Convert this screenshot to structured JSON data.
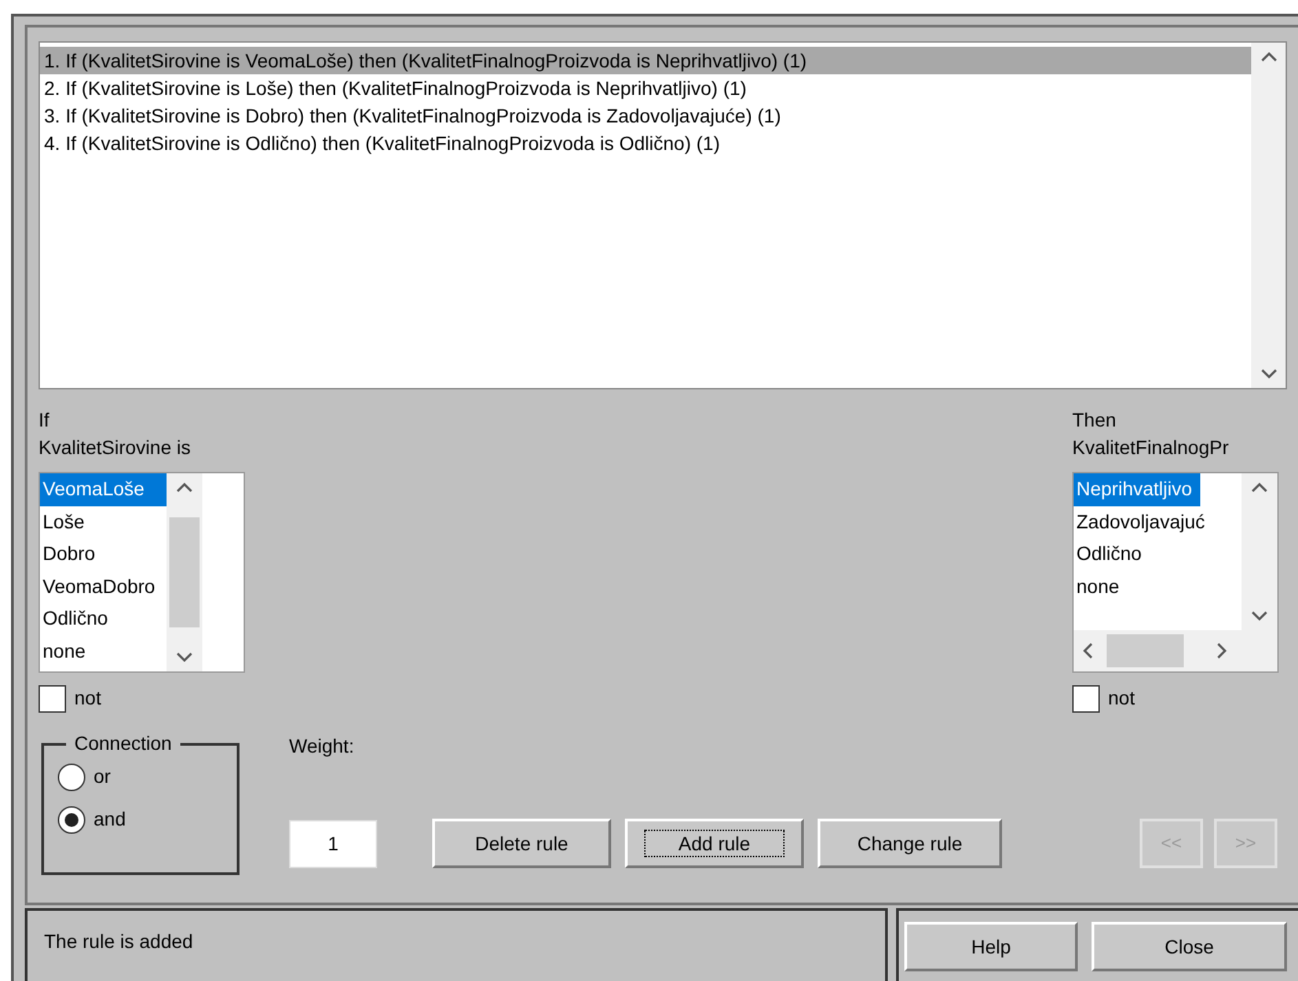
{
  "rules": [
    {
      "text": "1. If (KvalitetSirovine is VeomaLoše) then (KvalitetFinalnogProizvoda is Neprihvatljivo) (1)",
      "selected": true
    },
    {
      "text": "2. If (KvalitetSirovine is Loše) then (KvalitetFinalnogProizvoda is Neprihvatljivo) (1)",
      "selected": false
    },
    {
      "text": "3. If (KvalitetSirovine is Dobro) then (KvalitetFinalnogProizvoda is Zadovoljavajuće) (1)",
      "selected": false
    },
    {
      "text": "4. If (KvalitetSirovine is Odlično) then (KvalitetFinalnogProizvoda is Odlično) (1)",
      "selected": false
    }
  ],
  "if_panel": {
    "label": "If",
    "variable": "KvalitetSirovine is",
    "items": [
      {
        "label": "VeomaLoše",
        "selected": true
      },
      {
        "label": "Loše",
        "selected": false
      },
      {
        "label": "Dobro",
        "selected": false
      },
      {
        "label": "VeomaDobro",
        "selected": false
      },
      {
        "label": "Odlično",
        "selected": false
      },
      {
        "label": "none",
        "selected": false
      }
    ],
    "not": {
      "label": "not",
      "checked": false
    }
  },
  "then_panel": {
    "label": "Then",
    "variable": "KvalitetFinalnogPr",
    "items": [
      {
        "label": "Neprihvatljivo",
        "selected": true
      },
      {
        "label": "Zadovoljavajuć",
        "selected": false
      },
      {
        "label": "Odlično",
        "selected": false
      },
      {
        "label": "none",
        "selected": false
      }
    ],
    "not": {
      "label": "not",
      "checked": false
    }
  },
  "connection": {
    "title": "Connection",
    "options": [
      {
        "label": "or",
        "selected": false
      },
      {
        "label": "and",
        "selected": true
      }
    ]
  },
  "weight": {
    "label": "Weight:",
    "value": "1"
  },
  "rule_buttons": [
    {
      "label": "Delete rule",
      "focused": false
    },
    {
      "label": "Add rule",
      "focused": true
    },
    {
      "label": "Change rule",
      "focused": false
    }
  ],
  "nav_buttons": [
    {
      "label": "<<",
      "disabled": true
    },
    {
      "label": ">>",
      "disabled": true
    }
  ],
  "status": "The rule is added",
  "footer_buttons": [
    "Help",
    "Close"
  ]
}
